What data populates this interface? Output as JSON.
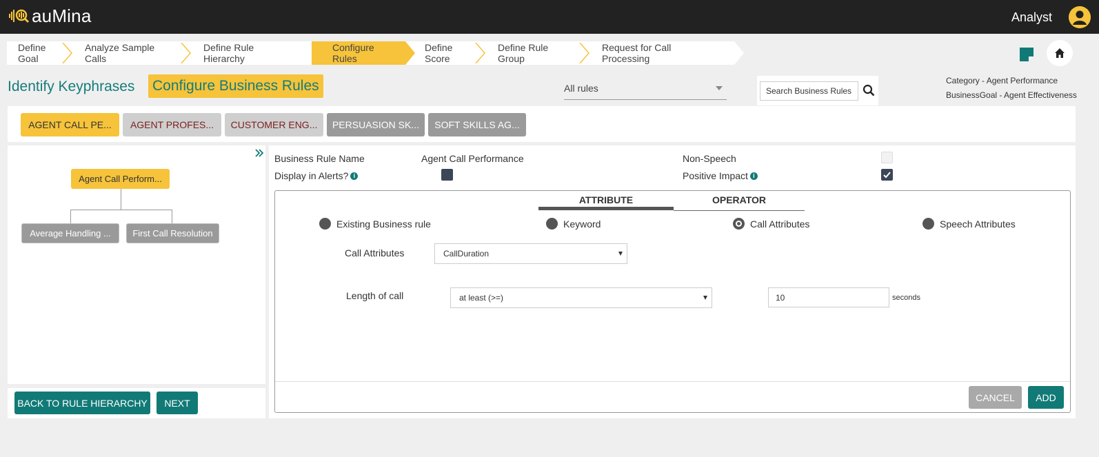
{
  "app": {
    "name": "auMina",
    "user_role": "Analyst"
  },
  "colors": {
    "accent_yellow": "#f6c33a",
    "teal": "#117a77",
    "topbar": "#222222"
  },
  "stepper": {
    "steps": [
      {
        "label": "Define Goal"
      },
      {
        "label": "Analyze Sample Calls"
      },
      {
        "label": "Define Rule Hierarchy"
      },
      {
        "label": "Configure Rules",
        "active": true
      },
      {
        "label": "Define Score"
      },
      {
        "label": "Define Rule Group"
      },
      {
        "label": "Request for Call Processing"
      }
    ]
  },
  "header": {
    "identify_title": "Identify Keyphrases",
    "configure_title": "Configure Business Rules",
    "rules_filter": "All rules",
    "search_placeholder": "Search Business Rules",
    "category_text": "Category - Agent Performance",
    "business_goal_text": "BusinessGoal - Agent Effectiveness"
  },
  "category_tabs": [
    {
      "label": "AGENT CALL PE...",
      "state": "selected"
    },
    {
      "label": "AGENT PROFES...",
      "state": "light"
    },
    {
      "label": "CUSTOMER ENG...",
      "state": "light"
    },
    {
      "label": "PERSUASION SK...",
      "state": "dark"
    },
    {
      "label": "SOFT SKILLS AG...",
      "state": "dark"
    }
  ],
  "tree": {
    "root": "Agent Call Perform...",
    "children": [
      "Average Handling ...",
      "First Call Resolution"
    ]
  },
  "left_buttons": {
    "back": "BACK TO RULE HIERARCHY",
    "next": "NEXT"
  },
  "rule": {
    "name_label": "Business Rule Name",
    "name_value": "Agent Call Performance",
    "alerts_label": "Display in Alerts?",
    "alerts_checked": true,
    "non_speech_label": "Non-Speech",
    "non_speech_checked": false,
    "positive_impact_label": "Positive Impact",
    "positive_impact_checked": true
  },
  "editor": {
    "tabs": [
      {
        "label": "ATTRIBUTE",
        "active": true
      },
      {
        "label": "OPERATOR"
      }
    ],
    "radio_options": [
      {
        "label": "Existing Business rule",
        "checked": false
      },
      {
        "label": "Keyword",
        "checked": false
      },
      {
        "label": "Call Attributes",
        "checked": true
      },
      {
        "label": "Speech Attributes",
        "checked": false
      }
    ],
    "call_attr_label": "Call Attributes",
    "call_attr_value": "CallDuration",
    "length_label": "Length of call",
    "length_operator": "at least (>=)",
    "length_value": "10",
    "length_unit": "seconds",
    "cancel_label": "CANCEL",
    "add_label": "ADD"
  }
}
